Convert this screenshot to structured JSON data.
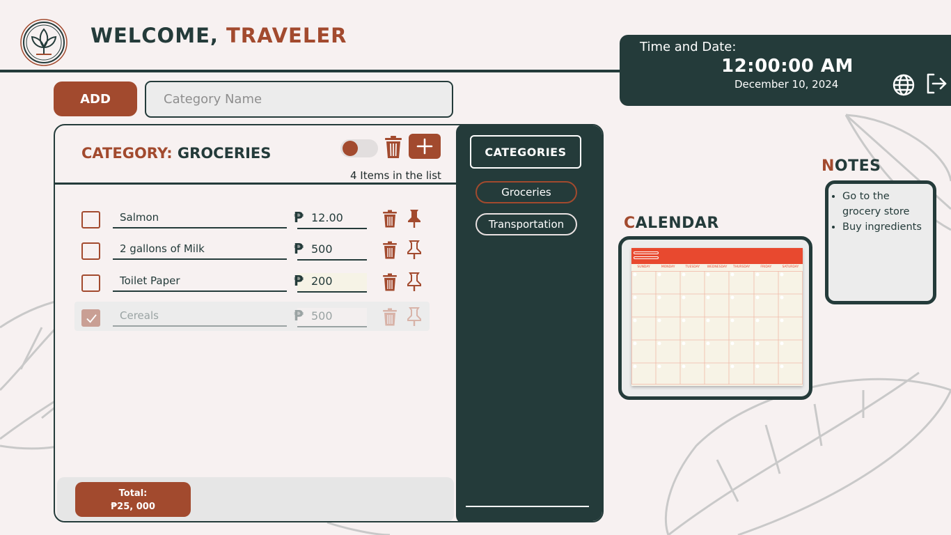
{
  "header": {
    "welcome_prefix": "WELCOME,",
    "welcome_name": "TRAVELER"
  },
  "clock": {
    "label": "Time and Date:",
    "time": "12:00:00 AM",
    "date": "December 10, 2024"
  },
  "add_bar": {
    "add_label": "ADD",
    "input_placeholder": "Category Name",
    "input_value": ""
  },
  "list": {
    "category_label": "CATEGORY:",
    "category_name": "GROCERIES",
    "item_count": "4 Items in the list",
    "currency": "₱",
    "items": [
      {
        "name": "Salmon",
        "price": "12.00",
        "checked": false
      },
      {
        "name": "2 gallons of Milk",
        "price": "500",
        "checked": false
      },
      {
        "name": "Toilet Paper",
        "price": "200",
        "checked": false
      },
      {
        "name": "Cereals",
        "price": "500",
        "checked": true
      }
    ],
    "total_label": "Total:",
    "total_value": "₱25, 000"
  },
  "categories": {
    "heading": "CATEGORIES",
    "items": [
      "Groceries",
      "Transportation"
    ],
    "active": "Groceries"
  },
  "calendar": {
    "title_first": "C",
    "title_rest": "ALENDAR",
    "weekdays": [
      "SUNDAY",
      "MONDAY",
      "TUESDAY",
      "WEDNESDAY",
      "THURSDAY",
      "FRIDAY",
      "SATURDAY"
    ]
  },
  "notes": {
    "title_first": "N",
    "title_rest": "OTES",
    "items": [
      "Go to the grocery store",
      "Buy ingredients"
    ]
  },
  "colors": {
    "primary_dark": "#243b3a",
    "accent": "#a24a2e",
    "background": "#f7f1f1",
    "calendar_red": "#e8492f"
  },
  "icons": {
    "logo": "leaf-logo-icon",
    "globe": "globe-icon",
    "logout": "logout-icon",
    "trash": "trash-icon",
    "pin": "pin-icon",
    "plus": "plus-icon",
    "check": "check-icon"
  }
}
